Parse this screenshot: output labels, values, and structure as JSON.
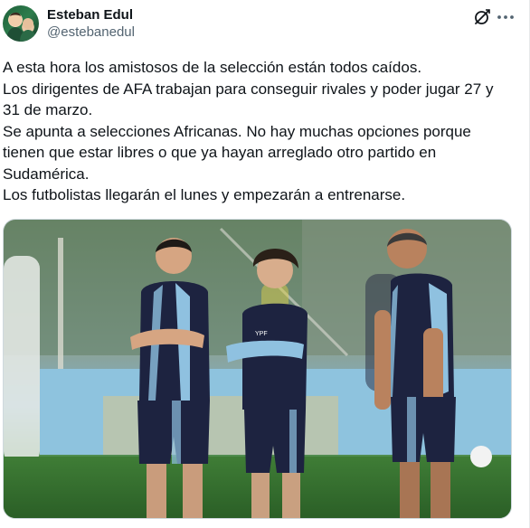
{
  "author": {
    "display_name": "Esteban Edul",
    "handle": "@estebanedul",
    "avatar_icon": "profile-photo"
  },
  "actions": {
    "grok_icon": "grok-icon",
    "more_icon": "more-dots-icon"
  },
  "tweet": {
    "lines": [
      "A esta hora los amistosos de la selección están todos caídos.",
      "Los dirigentes de AFA trabajan para conseguir rivales y poder jugar 27 y",
      "31 de marzo.",
      "Se apunta a selecciones Africanas. No hay muchas opciones porque",
      "tienen que estar libres o que ya hayan arreglado otro partido en",
      "Sudamérica.",
      "Los futbolistas llegarán el lunes y empezarán a entrenarse."
    ]
  },
  "media": {
    "kind": "photo",
    "shirt_text": "YPF"
  },
  "colors": {
    "text_primary": "#0f1419",
    "text_secondary": "#536471",
    "border": "#cfd9de",
    "jersey_navy": "#1d2340",
    "jersey_sky": "#8fc1e0",
    "pitch_green": "#2f6b2c"
  }
}
